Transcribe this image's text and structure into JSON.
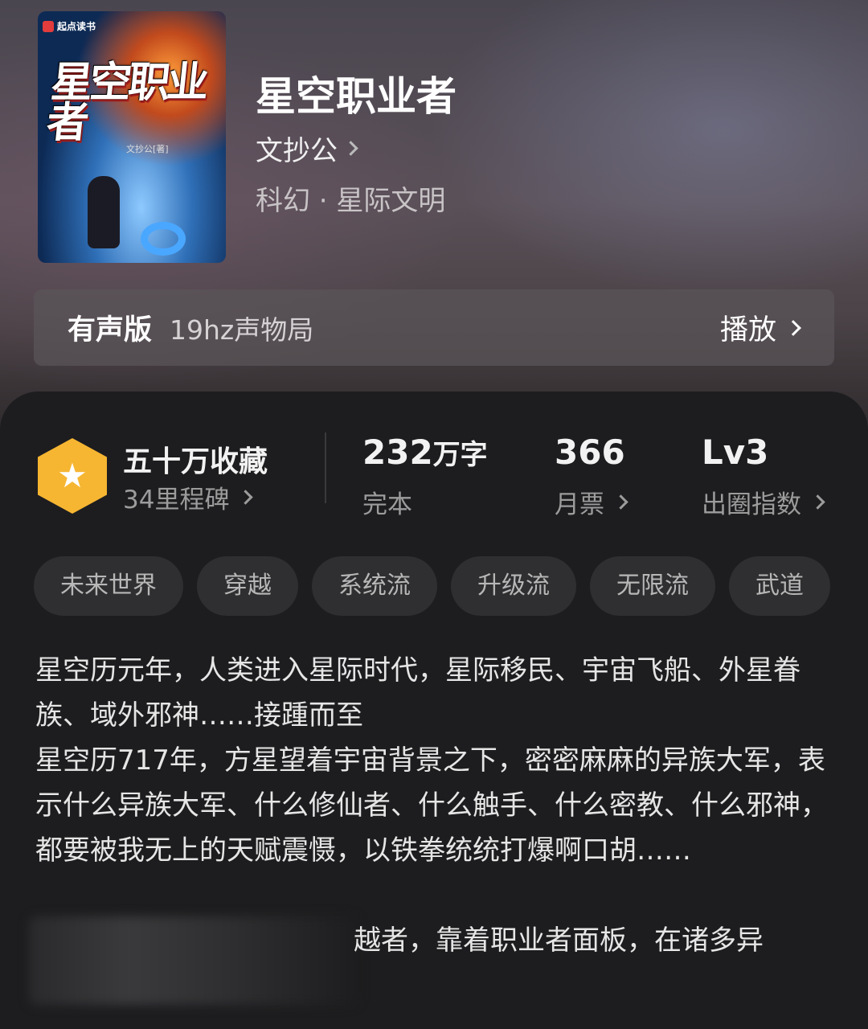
{
  "book": {
    "cover_publisher": "起点读书",
    "cover_title": "星空职业者",
    "cover_author": "文抄公[著]",
    "title": "星空职业者",
    "author": "文抄公",
    "genre": "科幻 · 星际文明"
  },
  "audio": {
    "label": "有声版",
    "narrator": "19hz声物局",
    "play_label": "播放"
  },
  "stats": {
    "collection": "五十万收藏",
    "milestone": "34里程碑",
    "word_count_num": "232",
    "word_count_unit": "万字",
    "status": "完本",
    "monthly_votes": "366",
    "monthly_votes_label": "月票",
    "level": "Lv3",
    "level_label": "出圈指数"
  },
  "tags": [
    "未来世界",
    "穿越",
    "系统流",
    "升级流",
    "无限流",
    "武道"
  ],
  "description": {
    "p1": "星空历元年，人类进入星际时代，星际移民、宇宙飞船、外星眷族、域外邪神……接踵而至",
    "p2": "星空历717年，方星望着宇宙背景之下，密密麻麻的异族大军，表示什么异族大军、什么修仙者、什么触手、什么密教、什么邪神，都要被我无上的天赋震慑，以铁拳统统打爆啊口胡……",
    "p3_visible": "越者，靠着职业者面板，在诸多异"
  },
  "colors": {
    "accent_hex": "#f6b632",
    "panel_bg": "#1d1d1f",
    "tag_bg": "#2f2f31"
  }
}
